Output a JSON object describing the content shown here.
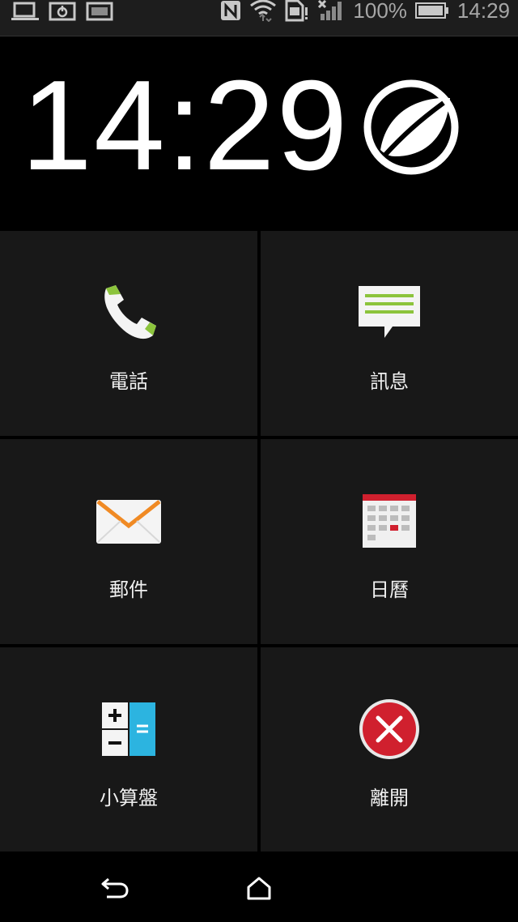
{
  "status_bar": {
    "battery_text": "100%",
    "time": "14:29",
    "icons_left": [
      "laptop-icon",
      "power-save-icon",
      "screenshot-icon"
    ],
    "icons_right": [
      "nfc-icon",
      "wifi-icon",
      "sim-alert-icon",
      "signal-icon",
      "battery-icon"
    ]
  },
  "header": {
    "clock": "14:29",
    "logo": "leaf-logo-icon"
  },
  "tiles": [
    {
      "label": "電話",
      "icon": "phone-icon"
    },
    {
      "label": "訊息",
      "icon": "message-icon"
    },
    {
      "label": "郵件",
      "icon": "mail-icon"
    },
    {
      "label": "日曆",
      "icon": "calendar-icon"
    },
    {
      "label": "小算盤",
      "icon": "calculator-icon"
    },
    {
      "label": "離開",
      "icon": "exit-icon"
    }
  ],
  "navbar": {
    "buttons": [
      "back-icon",
      "home-icon"
    ]
  },
  "colors": {
    "tile_bg": "#181818",
    "accent_green": "#8cc43c",
    "exit_red": "#d0202e",
    "calc_blue": "#2cb4e0",
    "mail_orange": "#f08a24"
  }
}
